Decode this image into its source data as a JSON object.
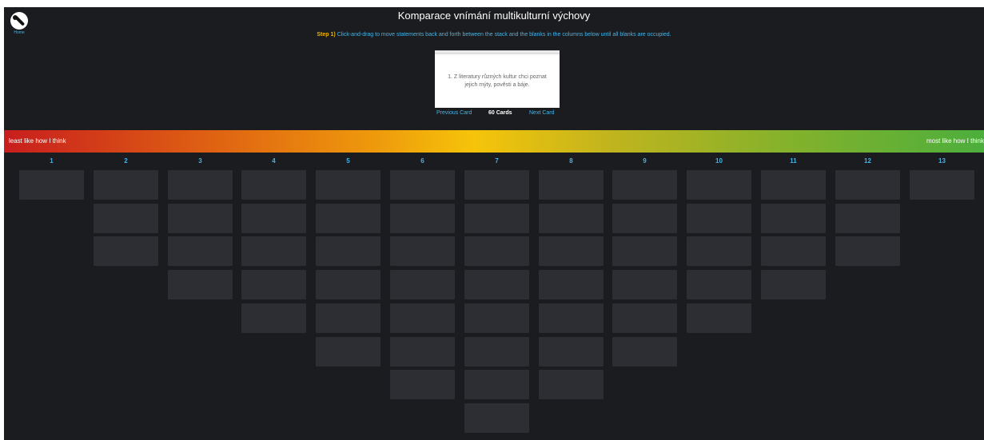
{
  "app": {
    "home_label": "Home",
    "title": "Komparace vnímání multikulturní výchovy",
    "instructions": {
      "step": "Step 1)",
      "text": "Click-and-drag to move statements back and forth between the stack and the blanks in the columns below until all blanks are occupied."
    }
  },
  "deck": {
    "current_card_text": "1. Z literatury různých kultur chci poznat jejich mýty, pověsti a báje.",
    "previous_label": "Previous Card",
    "count_label": "60 Cards",
    "next_label": "Next Card"
  },
  "scale": {
    "left_label": "least like how I think",
    "right_label": "most like how I think"
  },
  "columns": [
    {
      "label": "1",
      "blanks": 1
    },
    {
      "label": "2",
      "blanks": 3
    },
    {
      "label": "3",
      "blanks": 4
    },
    {
      "label": "4",
      "blanks": 5
    },
    {
      "label": "5",
      "blanks": 6
    },
    {
      "label": "6",
      "blanks": 7
    },
    {
      "label": "7",
      "blanks": 8
    },
    {
      "label": "8",
      "blanks": 7
    },
    {
      "label": "9",
      "blanks": 6
    },
    {
      "label": "10",
      "blanks": 5
    },
    {
      "label": "11",
      "blanks": 4
    },
    {
      "label": "12",
      "blanks": 3
    },
    {
      "label": "13",
      "blanks": 1
    }
  ],
  "colors": {
    "background": "#1b1c1f",
    "slot": "#2d2e33",
    "accent": "#45b4e8",
    "step": "#f0b400"
  }
}
